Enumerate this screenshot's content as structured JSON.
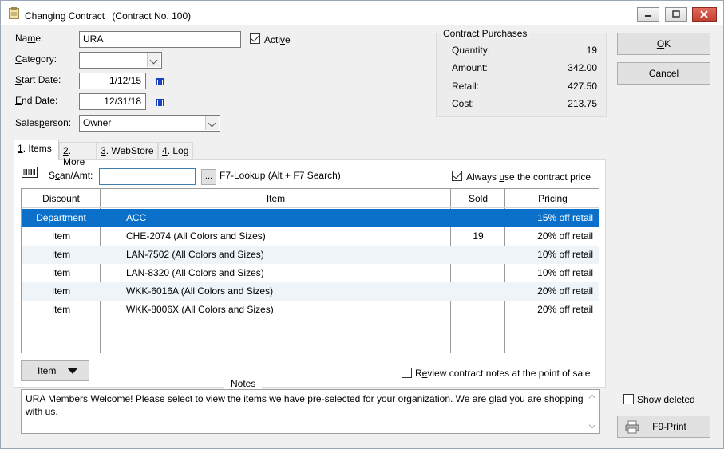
{
  "window": {
    "title": "Changing Contract",
    "contract_no": "(Contract No. 100)"
  },
  "form": {
    "name_label_pre": "Na",
    "name_label_u": "m",
    "name_label_post": "e:",
    "name_value": "URA",
    "active_label_pre": "Acti",
    "active_label_u": "v",
    "active_label_post": "e",
    "category_label_pre": "",
    "category_label_u": "C",
    "category_label_post": "ategory:",
    "category_value": "",
    "start_label_pre": "",
    "start_label_u": "S",
    "start_label_post": "tart Date:",
    "start_value": "1/12/15",
    "end_label_pre": "",
    "end_label_u": "E",
    "end_label_post": "nd Date:",
    "end_value": "12/31/18",
    "salesperson_label_pre": "Sales",
    "salesperson_label_u": "p",
    "salesperson_label_post": "erson:",
    "salesperson_value": "Owner"
  },
  "purchases": {
    "title": "Contract Purchases",
    "rows": [
      {
        "label": "Quantity:",
        "value": "19"
      },
      {
        "label": "Amount:",
        "value": "342.00"
      },
      {
        "label": "Retail:",
        "value": "427.50"
      },
      {
        "label": "Cost:",
        "value": "213.75"
      }
    ]
  },
  "buttons": {
    "ok_u": "O",
    "ok_post": "K",
    "cancel": "Cancel",
    "item": "Item",
    "lookup": "...",
    "print": "F9-Print"
  },
  "tabs": [
    {
      "u": "1",
      "label": ". Items"
    },
    {
      "u": "2",
      "label": ". More"
    },
    {
      "u": "3",
      "label": ". WebStore"
    },
    {
      "u": "4",
      "label": ". Log"
    }
  ],
  "scan": {
    "label_pre": "S",
    "label_u": "c",
    "label_post": "an/Amt:",
    "value": "",
    "lookup_hint": "F7-Lookup  (Alt + F7 Search)",
    "always_pre": "Always ",
    "always_u": "u",
    "always_post": "se the contract price"
  },
  "grid": {
    "headers": [
      "Discount",
      "Item",
      "Sold",
      "Pricing"
    ],
    "rows": [
      {
        "discount": "Department",
        "item": "ACC",
        "sold": "",
        "pricing": "15% off retail"
      },
      {
        "discount": "Item",
        "item": "CHE-2074  (All Colors and Sizes)",
        "sold": "19",
        "pricing": "20% off retail"
      },
      {
        "discount": "Item",
        "item": "LAN-7502  (All Colors and Sizes)",
        "sold": "",
        "pricing": "10% off retail"
      },
      {
        "discount": "Item",
        "item": "LAN-8320  (All Colors and Sizes)",
        "sold": "",
        "pricing": "10% off retail"
      },
      {
        "discount": "Item",
        "item": "WKK-6016A  (All Colors and Sizes)",
        "sold": "",
        "pricing": "20% off retail"
      },
      {
        "discount": "Item",
        "item": "WKK-8006X  (All Colors and Sizes)",
        "sold": "",
        "pricing": "20% off retail"
      }
    ]
  },
  "notes": {
    "label": "Notes",
    "review_pre": "R",
    "review_u": "e",
    "review_post": "view contract notes at the point of sale",
    "text": "URA Members Welcome! Please select to view the items we have pre-selected for your organization. We are glad you are shopping with us."
  },
  "show_deleted": {
    "pre": "Sho",
    "u": "w",
    "post": " deleted"
  },
  "colors": {
    "selection": "#0a70c9",
    "alt_row": "#eef4f8"
  }
}
